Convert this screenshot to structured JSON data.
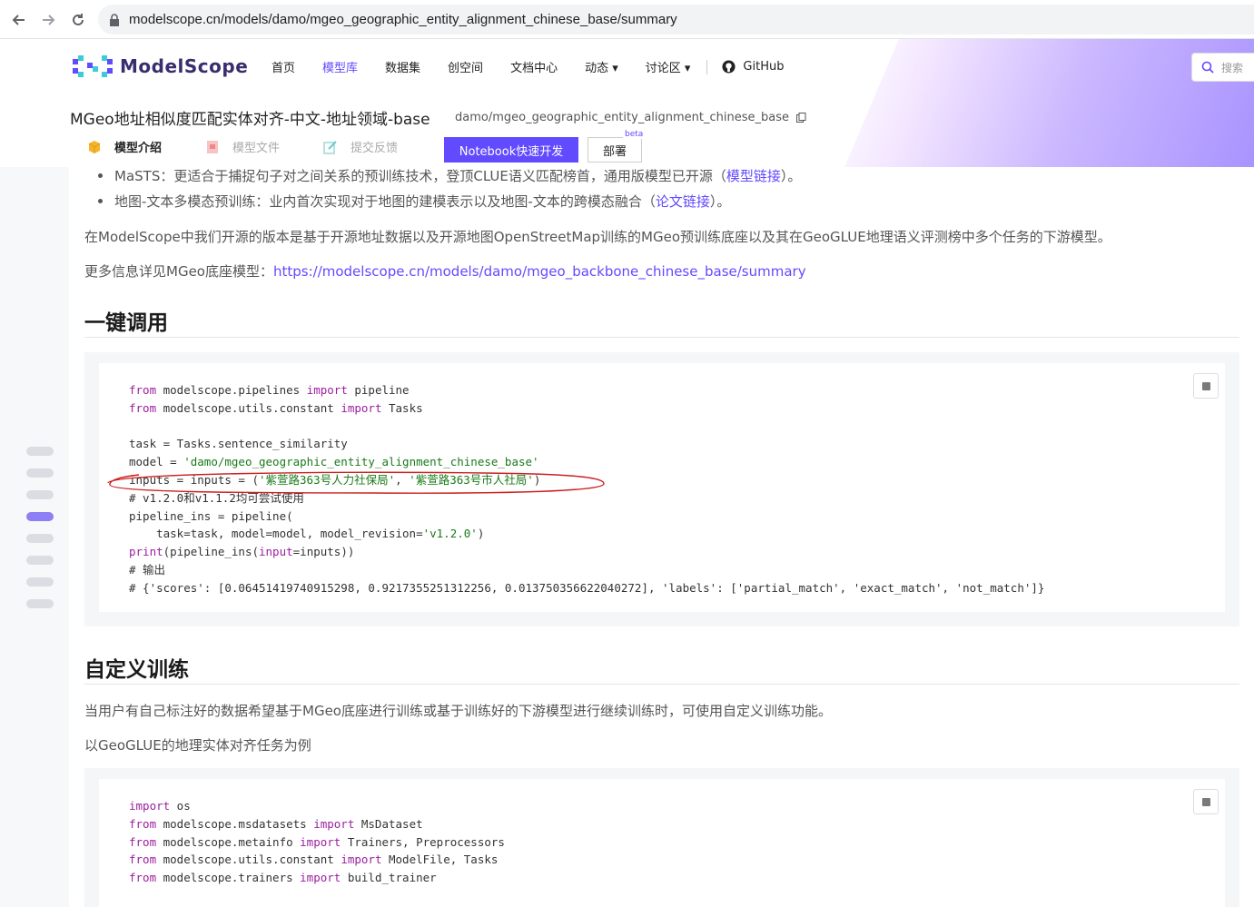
{
  "browser": {
    "url": "modelscope.cn/models/damo/mgeo_geographic_entity_alignment_chinese_base/summary"
  },
  "header": {
    "logo_text": "ModelScope",
    "menu": [
      {
        "label": "首页"
      },
      {
        "label": "模型库"
      },
      {
        "label": "数据集"
      },
      {
        "label": "创空间"
      },
      {
        "label": "文档中心"
      },
      {
        "label": "动态 ▾"
      },
      {
        "label": "讨论区 ▾"
      }
    ],
    "github": "GitHub",
    "search_placeholder": "搜索"
  },
  "model": {
    "title": "MGeo地址相似度匹配实体对齐-中文-地址领域-base",
    "id": "damo/mgeo_geographic_entity_alignment_chinese_base",
    "tabs": [
      {
        "label": "模型介绍"
      },
      {
        "label": "模型文件"
      },
      {
        "label": "提交反馈"
      }
    ],
    "notebook_btn": "Notebook快速开发",
    "deploy_btn": "部署",
    "beta": "beta"
  },
  "content": {
    "bullet1_prefix": "MaSTS：更适合于捕捉句子对之间关系的预训练技术，登顶CLUE语义匹配榜首，通用版模型已开源（",
    "bullet1_link": "模型链接",
    "bullet1_suffix": "）。",
    "bullet2_prefix": "地图-文本多模态预训练：业内首次实现对于地图的建模表示以及地图-文本的跨模态融合（",
    "bullet2_link": "论文链接",
    "bullet2_suffix": "）。",
    "para1": "在ModelScope中我们开源的版本是基于开源地址数据以及开源地图OpenStreetMap训练的MGeo预训练底座以及其在GeoGLUE地理语义评测榜中多个任务的下游模型。",
    "para2_prefix": "更多信息详见MGeo底座模型：",
    "para2_link": "https://modelscope.cn/models/damo/mgeo_backbone_chinese_base/summary",
    "h2_quick": "一键调用",
    "h2_train": "自定义训练",
    "para3": "当用户有自己标注好的数据希望基于MGeo底座进行训练或基于训练好的下游模型进行继续训练时，可使用自定义训练功能。",
    "para4": "以GeoGLUE的地理实体对齐任务为例"
  },
  "code1": [
    [
      {
        "t": "from",
        "c": "kw"
      },
      {
        "t": " modelscope.pipelines ",
        "c": ""
      },
      {
        "t": "import",
        "c": "kw"
      },
      {
        "t": " pipeline",
        "c": ""
      }
    ],
    [
      {
        "t": "from",
        "c": "kw"
      },
      {
        "t": " modelscope.utils.constant ",
        "c": ""
      },
      {
        "t": "import",
        "c": "kw"
      },
      {
        "t": " Tasks",
        "c": ""
      }
    ],
    [],
    [
      {
        "t": "task = Tasks.sentence_similarity",
        "c": ""
      }
    ],
    [
      {
        "t": "model = ",
        "c": ""
      },
      {
        "t": "'damo/mgeo_geographic_entity_alignment_chinese_base'",
        "c": "str"
      }
    ],
    [
      {
        "t": "inputs = inputs = (",
        "c": ""
      },
      {
        "t": "'紫萱路363号人力社保局'",
        "c": "str"
      },
      {
        "t": ", ",
        "c": ""
      },
      {
        "t": "'紫萱路363号市人社局'",
        "c": "str"
      },
      {
        "t": ")",
        "c": ""
      }
    ],
    [
      {
        "t": "# v1.2.0和v1.1.2均可尝试使用",
        "c": "cm"
      }
    ],
    [
      {
        "t": "pipeline_ins = pipeline(",
        "c": ""
      }
    ],
    [
      {
        "t": "    task=task, model=model, model_revision=",
        "c": ""
      },
      {
        "t": "'v1.2.0'",
        "c": "str"
      },
      {
        "t": ")",
        "c": ""
      }
    ],
    [
      {
        "t": "print",
        "c": "kw"
      },
      {
        "t": "(pipeline_ins(",
        "c": ""
      },
      {
        "t": "input",
        "c": "kw"
      },
      {
        "t": "=inputs))",
        "c": ""
      }
    ],
    [
      {
        "t": "# 输出",
        "c": "cm"
      }
    ],
    [
      {
        "t": "# {'scores': [0.06451419740915298, 0.9217355251312256, 0.013750356622040272], 'labels': ['partial_match', 'exact_match', 'not_match']}",
        "c": "cm"
      }
    ]
  ],
  "code2": [
    [
      {
        "t": "import",
        "c": "kw"
      },
      {
        "t": " os",
        "c": ""
      }
    ],
    [
      {
        "t": "from",
        "c": "kw"
      },
      {
        "t": " modelscope.msdatasets ",
        "c": ""
      },
      {
        "t": "import",
        "c": "kw"
      },
      {
        "t": " MsDataset",
        "c": ""
      }
    ],
    [
      {
        "t": "from",
        "c": "kw"
      },
      {
        "t": " modelscope.metainfo ",
        "c": ""
      },
      {
        "t": "import",
        "c": "kw"
      },
      {
        "t": " Trainers, Preprocessors",
        "c": ""
      }
    ],
    [
      {
        "t": "from",
        "c": "kw"
      },
      {
        "t": " modelscope.utils.constant ",
        "c": ""
      },
      {
        "t": "import",
        "c": "kw"
      },
      {
        "t": " ModelFile, Tasks",
        "c": ""
      }
    ],
    [
      {
        "t": "from",
        "c": "kw"
      },
      {
        "t": " modelscope.trainers ",
        "c": ""
      },
      {
        "t": "import",
        "c": "kw"
      },
      {
        "t": " build_trainer",
        "c": ""
      }
    ]
  ],
  "colors": {
    "accent": "#624aff",
    "annotation": "#cc1f1f"
  }
}
